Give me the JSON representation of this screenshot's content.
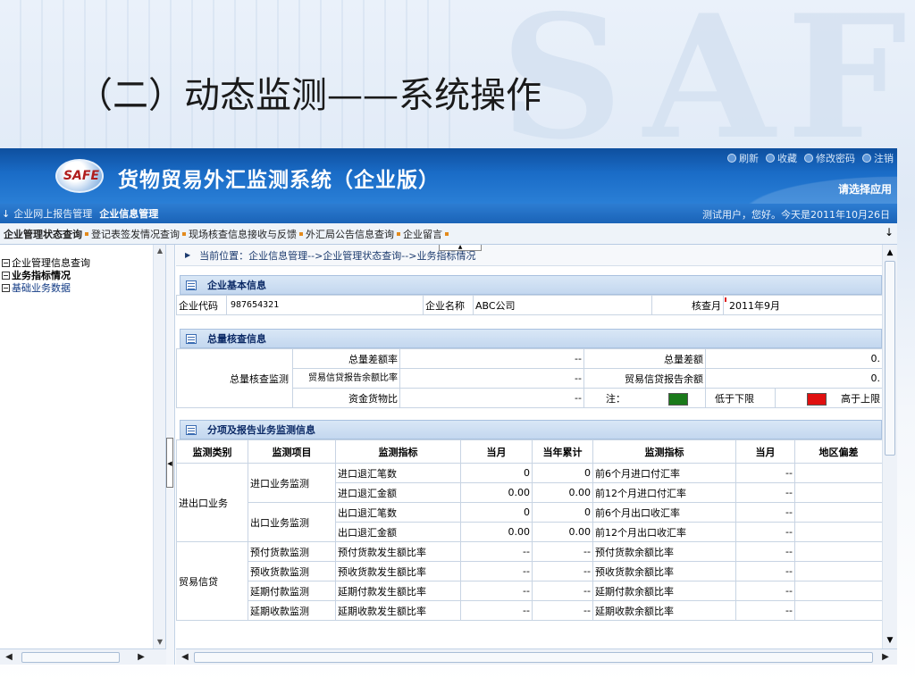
{
  "slide": {
    "title": "（二）动态监测——系统操作"
  },
  "header": {
    "logo_text": "SAFE",
    "app_title": "货物贸易外汇监测系统（企业版）",
    "top_links": [
      "刷新",
      "收藏",
      "修改密码",
      "注销"
    ],
    "choose_app": "请选择应用",
    "greeting": "测试用户，您好。今天是2011年10月26日"
  },
  "nav1": {
    "items": [
      "企业网上报告管理",
      "企业信息管理"
    ]
  },
  "nav2": {
    "items": [
      "企业管理状态查询",
      "登记表签发情况查询",
      "现场核查信息接收与反馈",
      "外汇局公告信息查询",
      "企业留言"
    ]
  },
  "tree": {
    "items": [
      "企业管理信息查询",
      "业务指标情况",
      "基础业务数据"
    ]
  },
  "breadcrumb": "当前位置：企业信息管理-->企业管理状态查询-->业务指标情况",
  "section1": {
    "title": "企业基本信息",
    "code_label": "企业代码",
    "code_value": "987654321",
    "name_label": "企业名称",
    "name_value": "ABC公司",
    "month_label": "核查月",
    "month_value": "2011年9月"
  },
  "section2": {
    "title": "总量核查信息",
    "group_label": "总量核查监测",
    "rows": [
      {
        "label": "总量差额率",
        "value": "--",
        "label2": "总量差额",
        "value2": "0."
      },
      {
        "label": "贸易信贷报告余额比率",
        "value": "--",
        "label2": "贸易信贷报告余额",
        "value2": "0."
      },
      {
        "label": "资金货物比",
        "value": "--",
        "note_label": "注：",
        "low_label": "低于下限",
        "high_label": "高于上限"
      }
    ],
    "low_color": "#1a7a1a",
    "high_color": "#e01010"
  },
  "section3": {
    "title": "分项及报告业务监测信息",
    "headers": [
      "监测类别",
      "监测项目",
      "监测指标",
      "当月",
      "当年累计",
      "监测指标",
      "当月",
      "地区偏差"
    ],
    "cat1": "进出口业务",
    "item1": "进口业务监测",
    "item2": "出口业务监测",
    "cat2": "贸易信贷",
    "rows": [
      {
        "item": "",
        "ind": "进口退汇笔数",
        "m": "0",
        "y": "0",
        "ind2": "前6个月进口付汇率",
        "m2": "--"
      },
      {
        "item": "",
        "ind": "进口退汇金额",
        "m": "0.00",
        "y": "0.00",
        "ind2": "前12个月进口付汇率",
        "m2": "--"
      },
      {
        "item": "",
        "ind": "出口退汇笔数",
        "m": "0",
        "y": "0",
        "ind2": "前6个月出口收汇率",
        "m2": "--"
      },
      {
        "item": "",
        "ind": "出口退汇金额",
        "m": "0.00",
        "y": "0.00",
        "ind2": "前12个月出口收汇率",
        "m2": "--"
      },
      {
        "item": "预付货款监测",
        "ind": "预付货款发生额比率",
        "m": "--",
        "y": "--",
        "ind2": "预付货款余额比率",
        "m2": "--"
      },
      {
        "item": "预收货款监测",
        "ind": "预收货款发生额比率",
        "m": "--",
        "y": "--",
        "ind2": "预收货款余额比率",
        "m2": "--"
      },
      {
        "item": "延期付款监测",
        "ind": "延期付款发生额比率",
        "m": "--",
        "y": "--",
        "ind2": "延期付款余额比率",
        "m2": "--"
      },
      {
        "item": "延期收款监测",
        "ind": "延期收款发生额比率",
        "m": "--",
        "y": "--",
        "ind2": "延期收款余额比率",
        "m2": "--"
      }
    ]
  }
}
